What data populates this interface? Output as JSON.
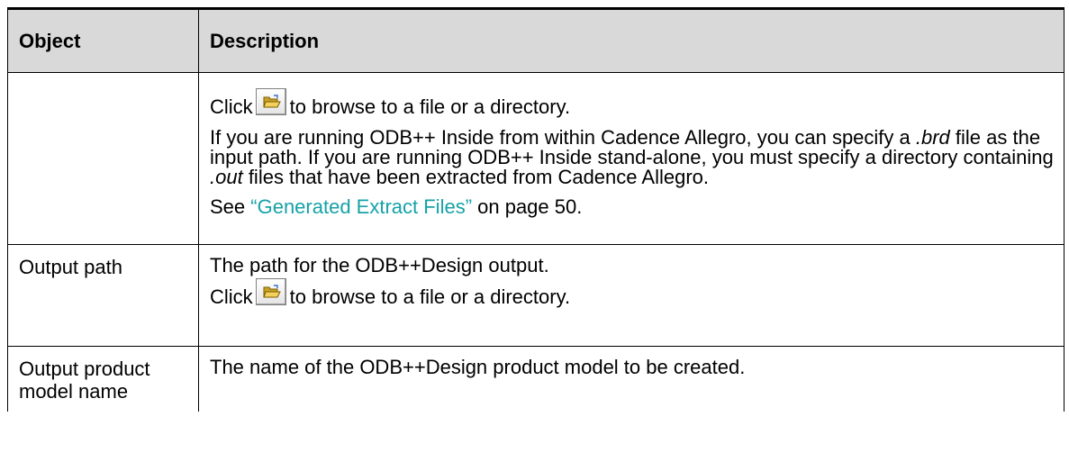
{
  "table": {
    "headers": [
      "Object",
      "Description"
    ],
    "rows": [
      {
        "object": "",
        "click_before": "Click",
        "click_after": "to browse to a file or a directory.",
        "para_lead": "If you are running ODB++ Inside from within Cadence Allegro, you can specify a ",
        "para_brd": ".brd",
        "para_mid": " file as the input path. If you are running ODB++ Inside stand-alone, you must specify a directory containing ",
        "para_out": ".out",
        "para_tail": " files that have been extracted from Cadence Allegro.",
        "see_prefix": "See ",
        "see_link": "“Generated Extract Files”",
        "see_suffix": " on page 50."
      },
      {
        "object": "Output path",
        "desc": "The path for the ODB++Design output.",
        "click_before": "Click",
        "click_after": "to browse to a file or a directory."
      },
      {
        "object": "Output product model name",
        "desc": "The name of the ODB++Design product model to be created."
      }
    ]
  },
  "colors": {
    "header_bg": "#d9d9d9",
    "link": "#17a2a8",
    "border": "#000000"
  },
  "icons": {
    "browse_button": "open-folder-icon"
  }
}
